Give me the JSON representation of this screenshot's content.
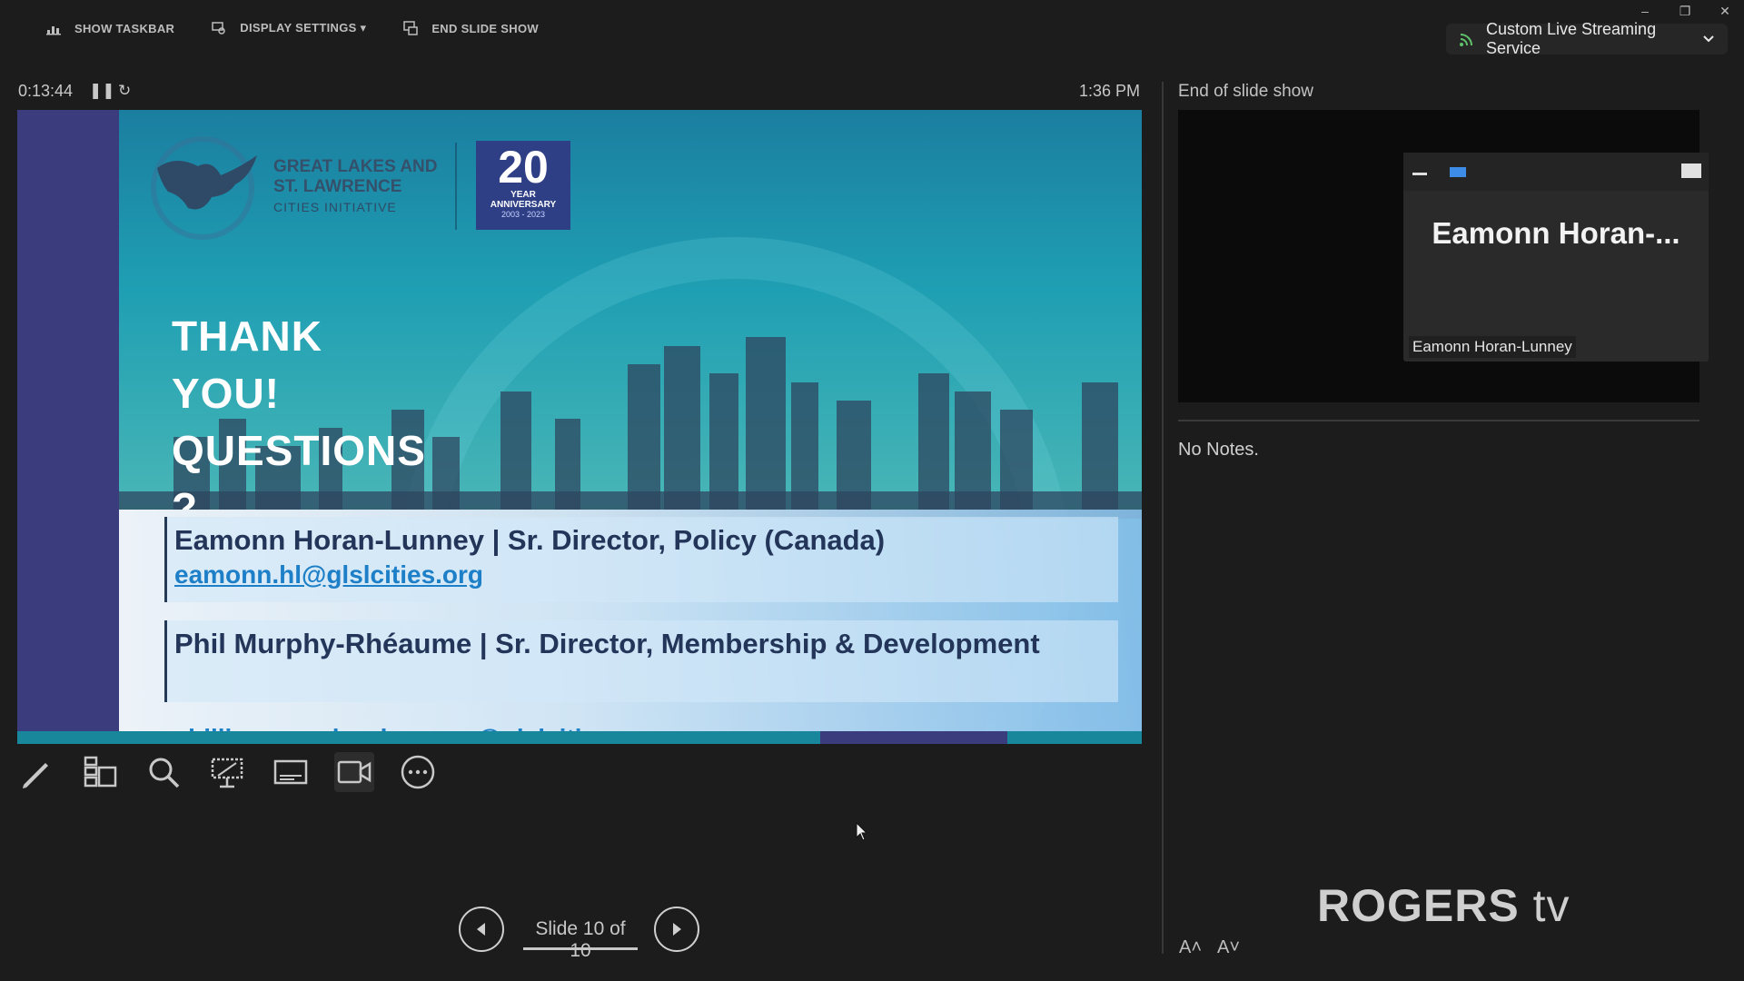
{
  "toolbar": {
    "show_taskbar": "SHOW TASKBAR",
    "display_settings": "DISPLAY SETTINGS ▾",
    "end_slide_show": "END SLIDE SHOW"
  },
  "window_controls": {
    "minimize": "–",
    "restore": "❐",
    "close": "✕"
  },
  "streaming": {
    "label": "Custom Live Streaming Service"
  },
  "timer": {
    "elapsed": "0:13:44",
    "clock": "1:36 PM"
  },
  "slide": {
    "logo_line1": "GREAT LAKES AND",
    "logo_line2": "ST. LAWRENCE",
    "logo_line3": "CITIES INITIATIVE",
    "anniv_number": "20",
    "anniv_line1": "YEAR",
    "anniv_line2": "ANNIVERSARY",
    "anniv_years": "2003 - 2023",
    "headline_line1": "THANK",
    "headline_line2": "YOU!",
    "headline_line3": "QUESTIONS",
    "headline_line4": "?",
    "contact1_name": "Eamonn Horan-Lunney | Sr. Director, Policy (Canada)",
    "contact1_email": "eamonn.hl@glslcities.org",
    "contact2_name": "Phil Murphy-Rhéaume | Sr. Director, Membership & Development",
    "contact2_email": "phillipe.murphy-rheaume@glslcities.org"
  },
  "tools": [
    "pen-icon",
    "slides-grid-icon",
    "zoom-icon",
    "pointer-screen-icon",
    "subtitles-icon",
    "camera-icon",
    "more-icon"
  ],
  "navigation": {
    "counter": "Slide 10 of 10"
  },
  "next_slide": {
    "title": "End of slide show"
  },
  "pip": {
    "display_name": "Eamonn  Horan-...",
    "label": "Eamonn Horan-Lunney"
  },
  "notes": {
    "text": "No Notes."
  },
  "watermark": {
    "brand": "ROGERS",
    "suffix": "tv"
  },
  "font_controls": {
    "increase": "A˄",
    "decrease": "A˅"
  },
  "colors": {
    "accent": "#3d8de8",
    "slide_band": "#3b3c7e",
    "teal": "#1d9ab1"
  }
}
